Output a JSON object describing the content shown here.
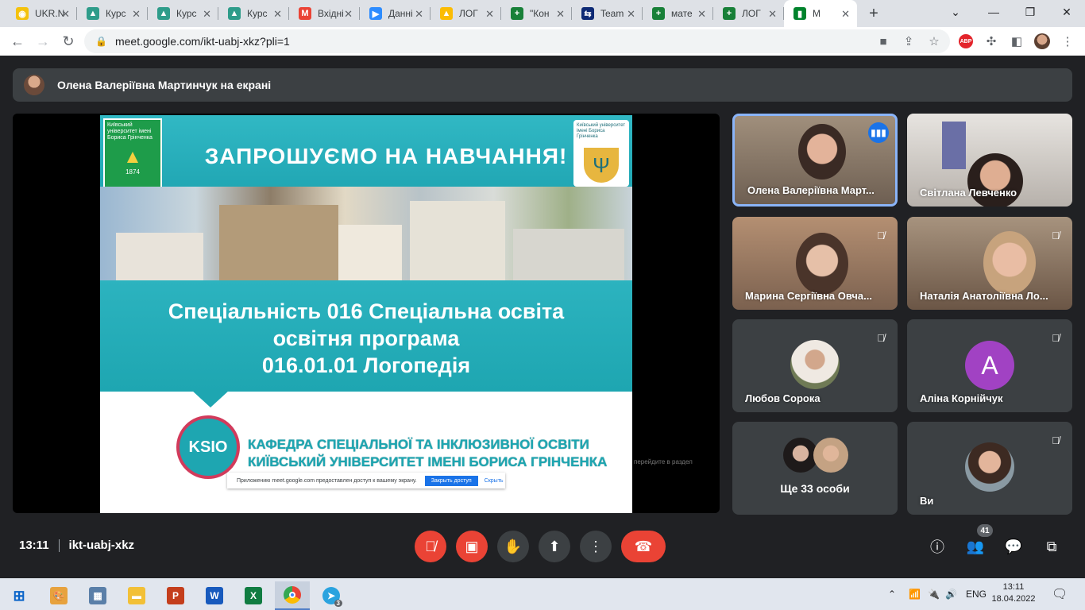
{
  "browser": {
    "tabs": [
      {
        "title": "UKR.NET",
        "color": "#f4c20d",
        "glyph": "◉"
      },
      {
        "title": "Курс",
        "color": "#2e9c8a",
        "glyph": "▲"
      },
      {
        "title": "Курс",
        "color": "#2e9c8a",
        "glyph": "▲"
      },
      {
        "title": "Курс",
        "color": "#2e9c8a",
        "glyph": "▲"
      },
      {
        "title": "Вхідні",
        "color": "#ea4335",
        "glyph": "M"
      },
      {
        "title": "Данні",
        "color": "#2d8cff",
        "glyph": "▶"
      },
      {
        "title": "ЛОГ",
        "color": "#fbbc04",
        "glyph": "▲"
      },
      {
        "title": "\"Кон",
        "color": "#188038",
        "glyph": "+"
      },
      {
        "title": "Team",
        "color": "#0e2a75",
        "glyph": "⇆"
      },
      {
        "title": "мате",
        "color": "#188038",
        "glyph": "+"
      },
      {
        "title": "ЛОГ",
        "color": "#188038",
        "glyph": "+"
      },
      {
        "title": "M",
        "color": "#00832d",
        "glyph": "▮",
        "active": true
      }
    ],
    "url": "meet.google.com/ikt-uabj-xkz?pli=1",
    "new_tab": "+",
    "abp": "ABP"
  },
  "meet": {
    "presenting_text": "Олена Валеріївна Мартинчук на екрані",
    "slide": {
      "title": "ЗАПРОШУЄМО НА НАВЧАННЯ!",
      "spec_line1": "Спеціальність 016 Спеціальна освіта",
      "spec_line2": "освітня програма",
      "spec_line3": "016.01.01 Логопедія",
      "ksio": "KSIO",
      "dept_line1": "КАФЕДРА СПЕЦІАЛЬНОЇ ТА ІНКЛЮЗИВНОЇ ОСВІТИ",
      "dept_line2": "КИЇВСЬКИЙ УНІВЕРСИТЕТ ІМЕНІ БОРИСА ГРІНЧЕНКА",
      "logo_left_text": "Київський університет імені Бориса Грінченка",
      "logo_left_year": "1874",
      "logo_right_text": "Київський університет імені Бориса Грінченка",
      "share_note": "Приложению meet.google.com предоставлен доступ к вашему экрану.",
      "share_btn": "Закрыть доступ",
      "share_hide": "Скрыть",
      "side_text": "перейдите в раздел"
    },
    "participants": [
      {
        "name": "Олена Валеріївна Март...",
        "state": "speaking"
      },
      {
        "name": "Світлана Левченко",
        "state": "video"
      },
      {
        "name": "Марина Сергіївна Овча...",
        "state": "muted"
      },
      {
        "name": "Наталія Анатоліївна Ло...",
        "state": "muted"
      },
      {
        "name": "Любов Сорока",
        "state": "muted"
      },
      {
        "name": "Аліна Корнійчук",
        "state": "muted",
        "letter": "A"
      },
      {
        "name": "Ще 33 особи",
        "state": "group"
      },
      {
        "name": "Ви",
        "state": "muted"
      }
    ],
    "time": "13:11",
    "meeting_code": "ikt-uabj-xkz",
    "participant_count": "41"
  },
  "taskbar": {
    "lang": "ENG",
    "time": "13:11",
    "date": "18.04.2022",
    "telegram_badge": "3"
  }
}
